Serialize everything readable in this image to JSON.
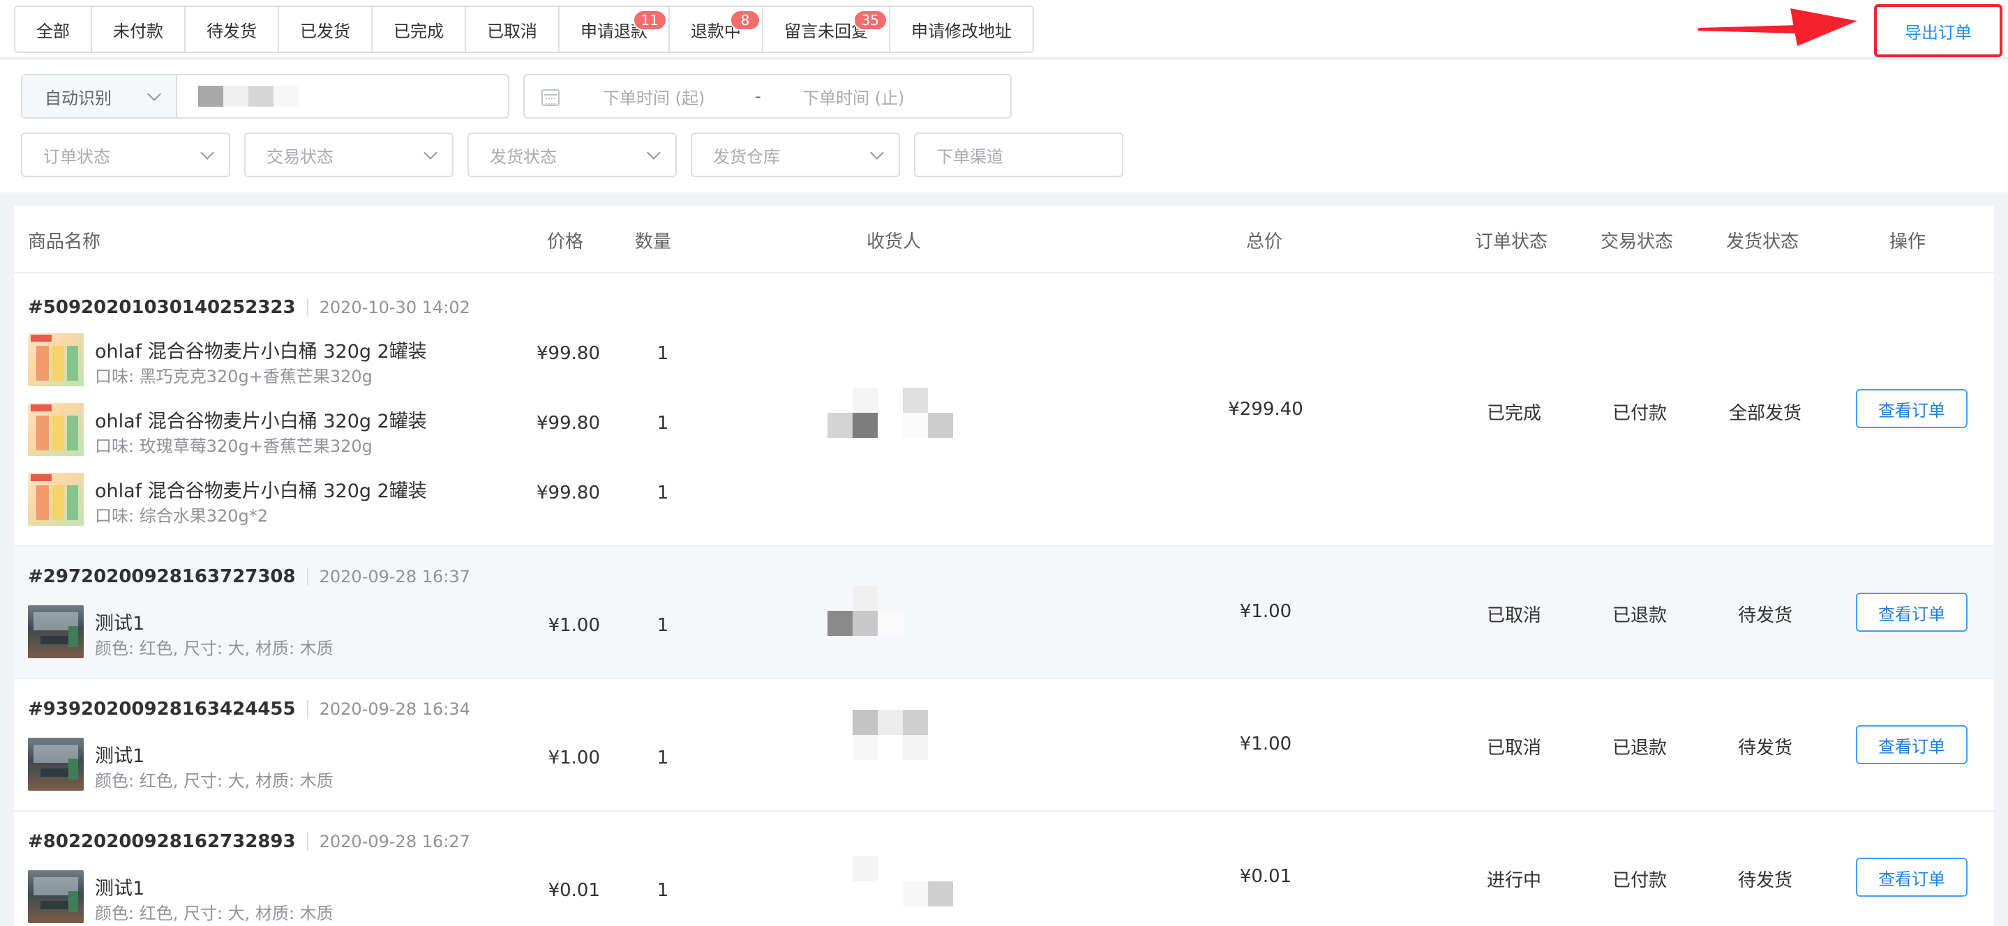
{
  "tabs": [
    {
      "label": "全部"
    },
    {
      "label": "未付款"
    },
    {
      "label": "待发货"
    },
    {
      "label": "已发货"
    },
    {
      "label": "已完成"
    },
    {
      "label": "已取消"
    },
    {
      "label": "申请退款",
      "badge": "11"
    },
    {
      "label": "退款中",
      "badge": "8"
    },
    {
      "label": "留言未回复",
      "badge": "35"
    },
    {
      "label": "申请修改地址"
    }
  ],
  "export_label": "导出订单",
  "filters": {
    "search_type": "自动识别",
    "date_start_placeholder": "下单时间 (起)",
    "date_sep": "-",
    "date_end_placeholder": "下单时间 (止)",
    "order_status": "订单状态",
    "trade_status": "交易状态",
    "ship_status": "发货状态",
    "warehouse": "发货仓库",
    "channel": "下单渠道"
  },
  "columns": {
    "product": "商品名称",
    "price": "价格",
    "qty": "数量",
    "receiver": "收货人",
    "total": "总价",
    "order_status": "订单状态",
    "trade_status": "交易状态",
    "ship_status": "发货状态",
    "action": "操作"
  },
  "orders": [
    {
      "no": "#5092020103014025​2323",
      "time": "2020-10-30 14:02",
      "total": "¥299.40",
      "order_status": "已完成",
      "trade_status": "已付款",
      "ship_status": "全部发货",
      "action": "查看订单",
      "items": [
        {
          "name": "ohlaf 混合谷物麦片小白桶 320g 2罐装",
          "spec": "口味: 黑巧克克320g+香蕉芒果320g",
          "price": "¥99.80",
          "qty": "1"
        },
        {
          "name": "ohlaf 混合谷物麦片小白桶 320g 2罐装",
          "spec": "口味: 玫瑰草莓320g+香蕉芒果320g",
          "price": "¥99.80",
          "qty": "1"
        },
        {
          "name": "ohlaf 混合谷物麦片小白桶 320g 2罐装",
          "spec": "口味: 综合水果320g*2",
          "price": "¥99.80",
          "qty": "1"
        }
      ]
    },
    {
      "no": "#29720200928163727308",
      "time": "2020-09-28 16:37",
      "total": "¥1.00",
      "order_status": "已取消",
      "trade_status": "已退款",
      "ship_status": "待发货",
      "action": "查看订单",
      "items": [
        {
          "name": "测试1",
          "spec": "颜色: 红色, 尺寸: 大, 材质: 木质",
          "price": "¥1.00",
          "qty": "1"
        }
      ]
    },
    {
      "no": "#93920200928163424455",
      "time": "2020-09-28 16:34",
      "total": "¥1.00",
      "order_status": "已取消",
      "trade_status": "已退款",
      "ship_status": "待发货",
      "action": "查看订单",
      "items": [
        {
          "name": "测试1",
          "spec": "颜色: 红色, 尺寸: 大, 材质: 木质",
          "price": "¥1.00",
          "qty": "1"
        }
      ]
    },
    {
      "no": "#80220200928162732893",
      "time": "2020-09-28 16:27",
      "total": "¥0.01",
      "order_status": "进行中",
      "trade_status": "已付款",
      "ship_status": "待发货",
      "action": "查看订单",
      "items": [
        {
          "name": "测试1",
          "spec": "颜色: 红色, 尺寸: 大, 材质: 木质",
          "price": "¥0.01",
          "qty": "1"
        }
      ]
    }
  ],
  "colors": {
    "accent": "#1890ff",
    "badge": "#f56c6c",
    "highlight_frame": "#f5222d"
  }
}
